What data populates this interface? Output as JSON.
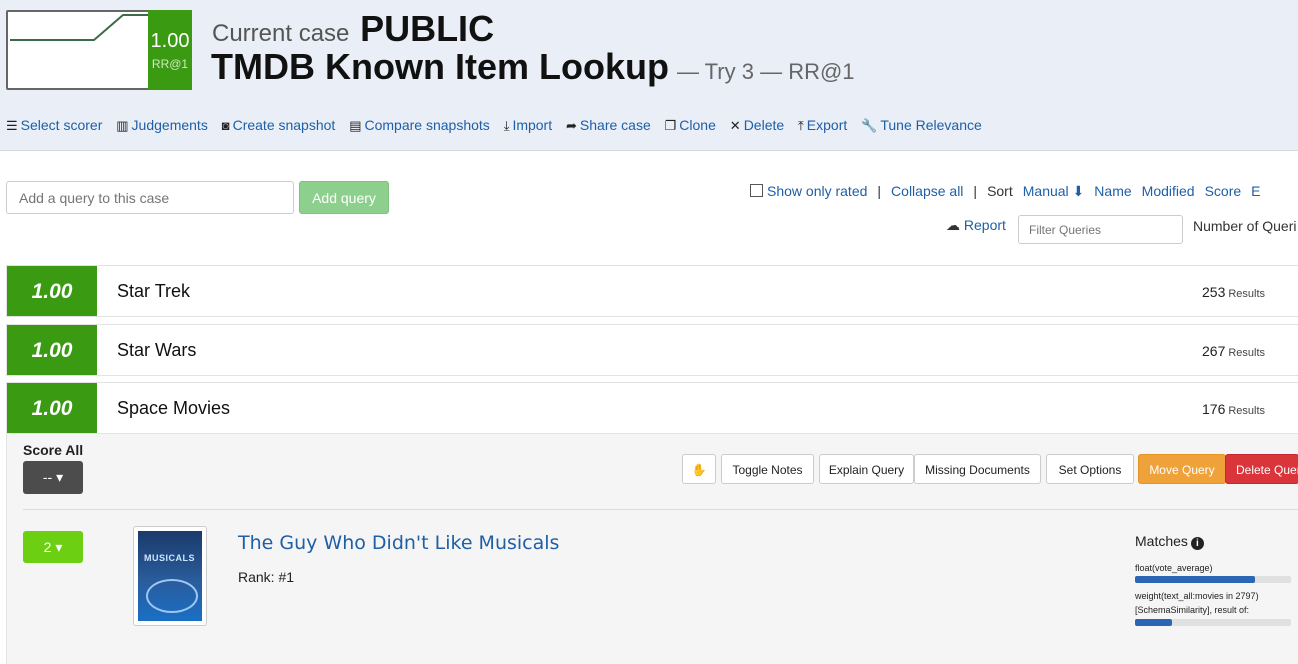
{
  "header": {
    "sparkline_score": "1.00",
    "sparkline_metric": "RR@1",
    "case_prefix": "Current case",
    "case_visibility": "PUBLIC",
    "case_name": "TMDB Known Item Lookup",
    "case_sub": "— Try 3 — RR@1"
  },
  "toolbar": [
    {
      "icon": "list-icon",
      "glyph": "☰",
      "label": "Select scorer"
    },
    {
      "icon": "book-icon",
      "glyph": "▥",
      "label": "Judgements"
    },
    {
      "icon": "camera-icon",
      "glyph": "◙",
      "label": "Create snapshot"
    },
    {
      "icon": "chart-icon",
      "glyph": "▤",
      "label": "Compare snapshots"
    },
    {
      "icon": "download-icon",
      "glyph": "⤓",
      "label": "Import"
    },
    {
      "icon": "share-icon",
      "glyph": "➦",
      "label": "Share case"
    },
    {
      "icon": "clone-icon",
      "glyph": "❐",
      "label": "Clone"
    },
    {
      "icon": "times-icon",
      "glyph": "✕",
      "label": "Delete"
    },
    {
      "icon": "upload-icon",
      "glyph": "⤒",
      "label": "Export"
    },
    {
      "icon": "wrench-icon",
      "glyph": "🔧",
      "label": "Tune Relevance"
    }
  ],
  "add_query": {
    "placeholder": "Add a query to this case",
    "button": "Add query"
  },
  "controls": {
    "show_only_rated": "Show only rated",
    "collapse_all": "Collapse all",
    "sort_label": "Sort",
    "sort_options": [
      "Manual ⬇",
      "Name",
      "Modified",
      "Score",
      "E"
    ],
    "report": "Report",
    "filter_placeholder": "Filter Queries",
    "number_of_queries": "Number of Queri"
  },
  "queries": [
    {
      "score": "1.00",
      "text": "Star Trek",
      "results": "253",
      "results_label": "Results"
    },
    {
      "score": "1.00",
      "text": "Star Wars",
      "results": "267",
      "results_label": "Results"
    },
    {
      "score": "1.00",
      "text": "Space Movies",
      "results": "176",
      "results_label": "Results"
    }
  ],
  "expanded": {
    "score_all_label": "Score All",
    "score_all_value": "-- ▾",
    "buttons": [
      "Toggle Notes",
      "Explain Query",
      "Missing Documents",
      "Set Options",
      "Move Query",
      "Delete Quer"
    ],
    "doc": {
      "rating": "2 ▾",
      "poster_text": "MUSICALS",
      "title": "The Guy Who Didn't Like Musicals",
      "rank": "Rank: #1",
      "matches_label": "Matches",
      "match_lines": [
        "float(vote_average)",
        "weight(text_all:movies in 2797)",
        "[SchemaSimilarity], result of:"
      ],
      "match_bar_fills": [
        0.77,
        0.24
      ]
    }
  },
  "colors": {
    "score_green": "#3a9a12",
    "link_blue": "#1f5fa6",
    "move_orange": "#efa13a",
    "delete_red": "#d9353a"
  }
}
